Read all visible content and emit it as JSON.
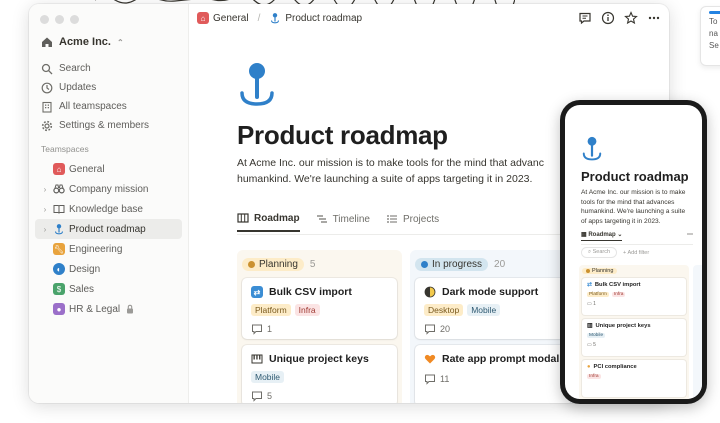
{
  "window": {
    "workspace": "Acme Inc.",
    "nav": [
      {
        "label": "Search",
        "icon": "search-icon"
      },
      {
        "label": "Updates",
        "icon": "clock-icon"
      },
      {
        "label": "All teamspaces",
        "icon": "building-icon"
      },
      {
        "label": "Settings & members",
        "icon": "gear-icon"
      }
    ],
    "teamspaces_label": "Teamspaces",
    "teamspaces": [
      {
        "label": "General",
        "icon": "home-icon",
        "color": "#e05a5a"
      },
      {
        "label": "Company mission",
        "icon": "binoculars-icon"
      },
      {
        "label": "Knowledge base",
        "icon": "book-icon"
      },
      {
        "label": "Product roadmap",
        "icon": "pin-icon"
      },
      {
        "label": "Engineering",
        "icon": "wrench-icon",
        "color": "#e8a33d"
      },
      {
        "label": "Design",
        "icon": "palette-icon",
        "color": "#2f80c9"
      },
      {
        "label": "Sales",
        "icon": "dollar-icon",
        "color": "#4aa36b"
      },
      {
        "label": "HR & Legal",
        "icon": "person-icon",
        "color": "#9b6fc9"
      }
    ]
  },
  "breadcrumb": {
    "parent": "General",
    "current": "Product roadmap"
  },
  "page": {
    "title": "Product roadmap",
    "description": "At Acme Inc. our mission is to make tools for the mind that advanc\nhumankind. We're launching a suite of apps targeting it in 2023."
  },
  "tabs": [
    {
      "label": "Roadmap",
      "icon": "board-icon",
      "active": true
    },
    {
      "label": "Timeline",
      "icon": "timeline-icon",
      "active": false
    },
    {
      "label": "Projects",
      "icon": "list-icon",
      "active": false
    }
  ],
  "board": {
    "columns": [
      {
        "name": "Planning",
        "count": "5",
        "color": "#cb912f",
        "pill_bg": "#fdecc8",
        "cards": [
          {
            "title": "Bulk CSV import",
            "icon": "arrows-icon",
            "tags": [
              "Platform",
              "Infra"
            ],
            "comments": "1"
          },
          {
            "title": "Unique project keys",
            "icon": "piano-icon",
            "tags": [
              "Mobile"
            ],
            "comments": "5"
          }
        ]
      },
      {
        "name": "In progress",
        "count": "20",
        "color": "#2f80c9",
        "pill_bg": "#d3e5ef",
        "cards": [
          {
            "title": "Dark mode support",
            "icon": "moon-icon",
            "tags": [
              "Desktop",
              "Mobile"
            ],
            "comments": "20"
          },
          {
            "title": "Rate app prompt modal",
            "icon": "heart-icon",
            "tags": [],
            "comments": "11"
          }
        ]
      }
    ]
  },
  "phone": {
    "title": "Product roadmap",
    "description": "At Acme Inc. our mission is to make\ntools for the mind that advances\nhumankind. We're launching a suite\nof apps targeting it in 2023.",
    "tab": "Roadmap",
    "search": "Search",
    "add_filter": "+ Add filter",
    "column": "Planning",
    "cards": [
      {
        "title": "Bulk CSV import",
        "tags": [
          "Platform",
          "Infra"
        ],
        "comments": "1"
      },
      {
        "title": "Unique project keys",
        "tags": [
          "Mobile"
        ],
        "comments": "5"
      },
      {
        "title": "PCI compliance",
        "tags": [
          "Infra"
        ],
        "comments": ""
      }
    ]
  },
  "side_card": {
    "lines": [
      "To",
      "na",
      "Se"
    ]
  }
}
